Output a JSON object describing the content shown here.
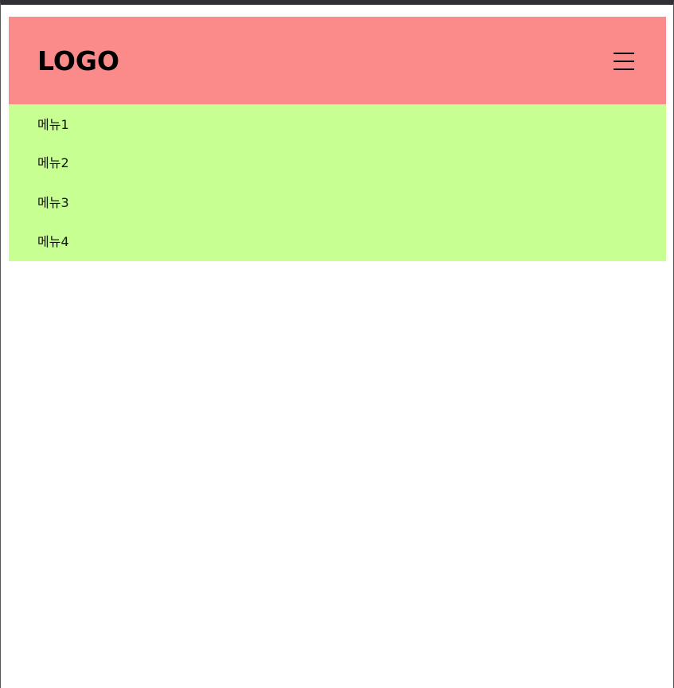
{
  "header": {
    "logo_text": "LOGO",
    "menu_button_icon": "hamburger-icon",
    "background_color": "#fb8b8a"
  },
  "menu": {
    "background_color": "#c7ff93",
    "items": [
      {
        "label": "메뉴1"
      },
      {
        "label": "메뉴2"
      },
      {
        "label": "메뉴3"
      },
      {
        "label": "메뉴4"
      }
    ]
  }
}
